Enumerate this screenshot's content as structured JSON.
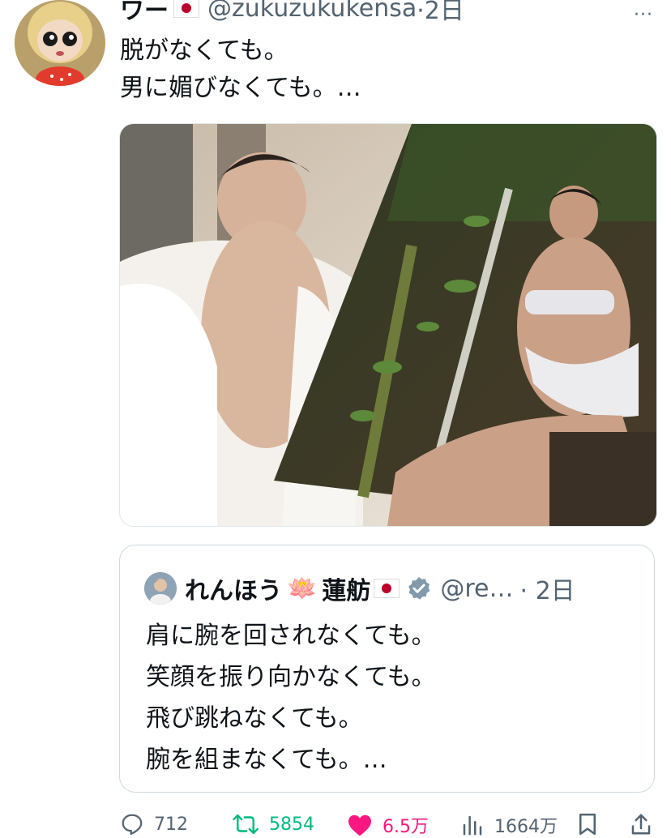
{
  "tweet": {
    "author_name": "ワー",
    "handle": "@zukuzukukensa",
    "time": "·2日",
    "more": "···",
    "text_lines": [
      "脱がなくても。",
      "男に媚びなくても。…"
    ]
  },
  "quote": {
    "name": "れんほう",
    "lotus": "🪷",
    "name_kanji": "蓮舫",
    "handle": "@re…",
    "time": "· 2日",
    "text_lines": [
      "肩に腕を回されなくても。",
      "笑顔を振り向かなくても。",
      "飛び跳ねなくても。",
      "腕を組まなくても。…"
    ]
  },
  "actions": {
    "replies": "712",
    "retweets": "5854",
    "likes": "6.5万",
    "views": "1664万"
  },
  "colors": {
    "retweet": "#00ba7c",
    "like": "#f91880",
    "muted": "#536471",
    "verified": "#829aab"
  },
  "icons": [
    "reply-icon",
    "retweet-icon",
    "like-icon",
    "views-icon",
    "bookmark-icon",
    "share-icon",
    "verified-icon",
    "japan-flag-icon"
  ]
}
